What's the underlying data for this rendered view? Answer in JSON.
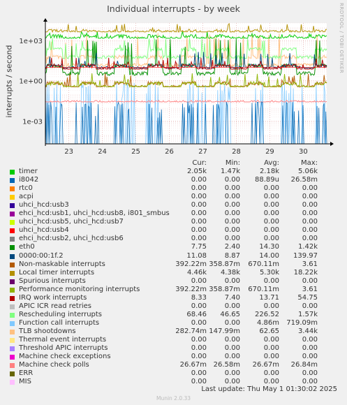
{
  "chart_data": {
    "type": "line",
    "title": "Individual interrupts - by week",
    "ylabel": "interrupts / second",
    "y_scale": "log",
    "ylim": [
      2e-05,
      20000
    ],
    "y_ticks": [
      "1e+03",
      "1e+00",
      "1e-03"
    ],
    "y_tick_values": [
      1000,
      1,
      0.001
    ],
    "x_ticks": [
      "23",
      "24",
      "25",
      "26",
      "27",
      "28",
      "29",
      "30"
    ],
    "x_range_days": [
      22.3,
      30.7
    ],
    "grid": true,
    "warning_line": 10,
    "columns": {
      "cur": "Cur:",
      "min": "Min:",
      "avg": "Avg:",
      "max": "Max:"
    },
    "series": [
      {
        "name": "timer",
        "color": "#00cc00",
        "cur": "2.05k",
        "min": "1.47k",
        "avg": "2.18k",
        "max": "5.06k"
      },
      {
        "name": "i8042",
        "color": "#0066b3",
        "cur": "0.00",
        "min": "0.00",
        "avg": "88.89u",
        "max": "26.58m"
      },
      {
        "name": "rtc0",
        "color": "#ff8000",
        "cur": "0.00",
        "min": "0.00",
        "avg": "0.00",
        "max": "0.00"
      },
      {
        "name": "acpi",
        "color": "#ffcc00",
        "cur": "0.00",
        "min": "0.00",
        "avg": "0.00",
        "max": "0.00"
      },
      {
        "name": "uhci_hcd:usb3",
        "color": "#330099",
        "cur": "0.00",
        "min": "0.00",
        "avg": "0.00",
        "max": "0.00"
      },
      {
        "name": "ehci_hcd:usb1, uhci_hcd:usb8, i801_smbus",
        "color": "#990099",
        "cur": "0.00",
        "min": "0.00",
        "avg": "0.00",
        "max": "0.00"
      },
      {
        "name": "uhci_hcd:usb5, uhci_hcd:usb7",
        "color": "#ccff00",
        "cur": "0.00",
        "min": "0.00",
        "avg": "0.00",
        "max": "0.00"
      },
      {
        "name": "uhci_hcd:usb4",
        "color": "#ff0000",
        "cur": "0.00",
        "min": "0.00",
        "avg": "0.00",
        "max": "0.00"
      },
      {
        "name": "ehci_hcd:usb2, uhci_hcd:usb6",
        "color": "#808080",
        "cur": "0.00",
        "min": "0.00",
        "avg": "0.00",
        "max": "0.00"
      },
      {
        "name": "eth0",
        "color": "#008f00",
        "cur": "7.75",
        "min": "2.40",
        "avg": "14.30",
        "max": "1.42k"
      },
      {
        "name": "0000:00:1f.2",
        "color": "#00487d",
        "cur": "11.08",
        "min": "8.87",
        "avg": "14.00",
        "max": "139.97"
      },
      {
        "name": "Non-maskable interrupts",
        "color": "#b35a00",
        "cur": "392.22m",
        "min": "358.87m",
        "avg": "670.11m",
        "max": "3.61"
      },
      {
        "name": "Local timer interrupts",
        "color": "#b38f00",
        "cur": "4.46k",
        "min": "4.38k",
        "avg": "5.30k",
        "max": "18.22k"
      },
      {
        "name": "Spurious interrupts",
        "color": "#6b006b",
        "cur": "0.00",
        "min": "0.00",
        "avg": "0.00",
        "max": "0.00"
      },
      {
        "name": "Performance monitoring interrupts",
        "color": "#8fb300",
        "cur": "392.22m",
        "min": "358.87m",
        "avg": "670.11m",
        "max": "3.61"
      },
      {
        "name": "IRQ work interrupts",
        "color": "#b30000",
        "cur": "8.33",
        "min": "7.40",
        "avg": "13.71",
        "max": "54.75"
      },
      {
        "name": "APIC ICR read retries",
        "color": "#bebebe",
        "cur": "0.00",
        "min": "0.00",
        "avg": "0.00",
        "max": "0.00"
      },
      {
        "name": "Rescheduling interrupts",
        "color": "#80ff80",
        "cur": "68.46",
        "min": "46.65",
        "avg": "226.52",
        "max": "1.57k"
      },
      {
        "name": "Function call interrupts",
        "color": "#80c9ff",
        "cur": "0.00",
        "min": "0.00",
        "avg": "4.86m",
        "max": "719.09m"
      },
      {
        "name": "TLB shootdowns",
        "color": "#ffc080",
        "cur": "282.74m",
        "min": "147.99m",
        "avg": "62.65",
        "max": "3.44k"
      },
      {
        "name": "Thermal event interrupts",
        "color": "#ffe680",
        "cur": "0.00",
        "min": "0.00",
        "avg": "0.00",
        "max": "0.00"
      },
      {
        "name": "Threshold APIC interrupts",
        "color": "#aa80ff",
        "cur": "0.00",
        "min": "0.00",
        "avg": "0.00",
        "max": "0.00"
      },
      {
        "name": "Machine check exceptions",
        "color": "#ee00cc",
        "cur": "0.00",
        "min": "0.00",
        "avg": "0.00",
        "max": "0.00"
      },
      {
        "name": "Machine check polls",
        "color": "#ff8080",
        "cur": "26.67m",
        "min": "26.58m",
        "avg": "26.67m",
        "max": "26.84m"
      },
      {
        "name": "ERR",
        "color": "#666600",
        "cur": "0.00",
        "min": "0.00",
        "avg": "0.00",
        "max": "0.00"
      },
      {
        "name": "MIS",
        "color": "#ffbfff",
        "cur": "0.00",
        "min": "0.00",
        "avg": "0.00",
        "max": "0.00"
      }
    ]
  },
  "side_credit": "RRDTOOL / TOBI OETIKER",
  "last_update": "Last update:  Thu May  1 01:30:02 2025",
  "munin_version": "Munin 2.0.33"
}
